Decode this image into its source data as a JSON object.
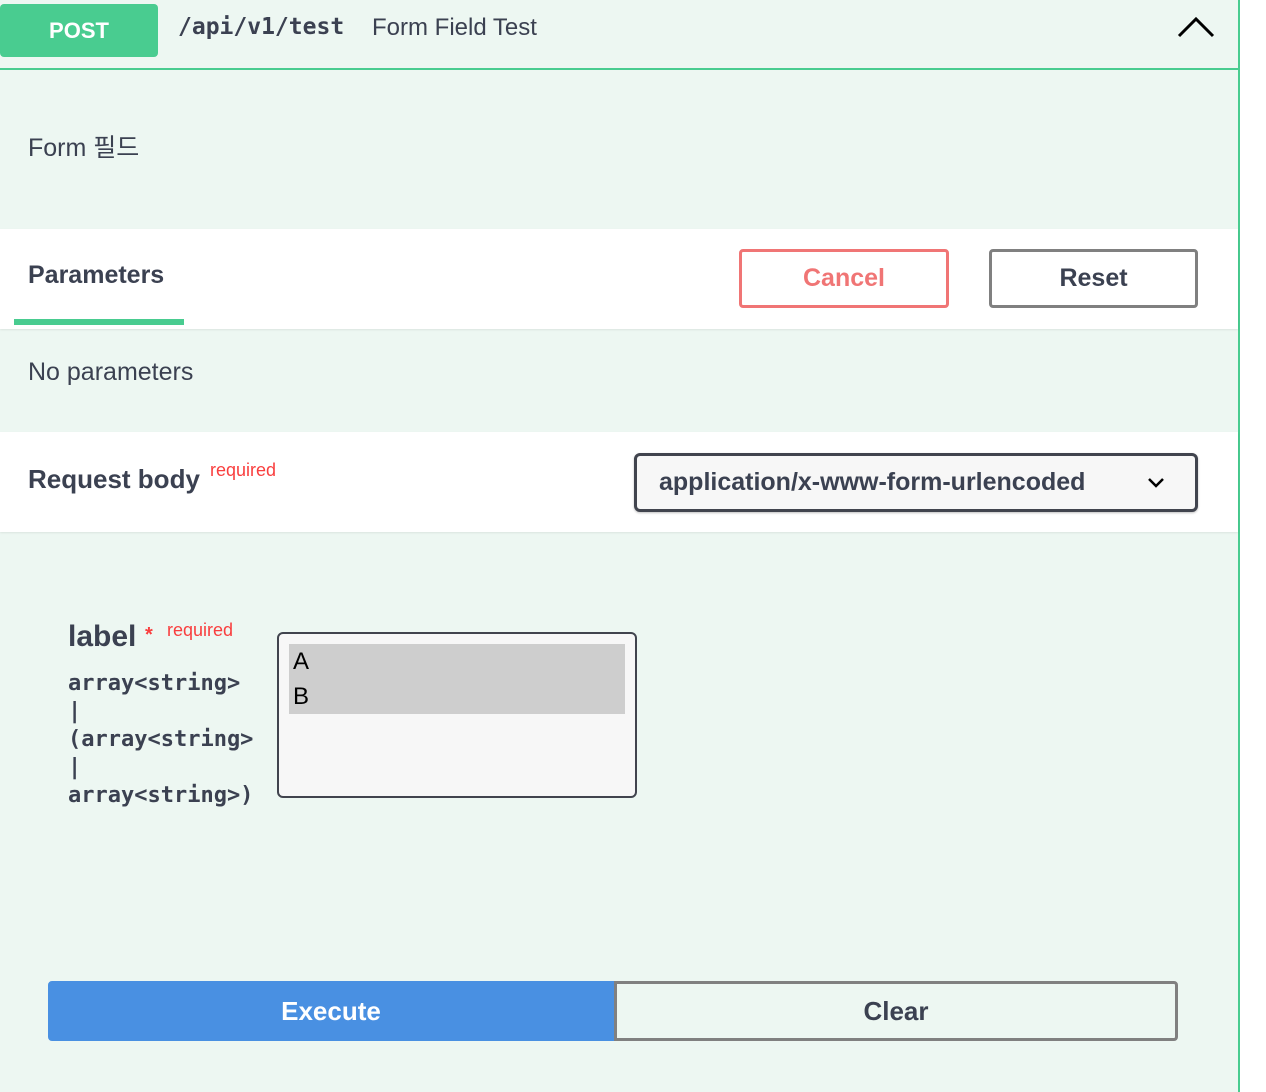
{
  "operation": {
    "method": "POST",
    "path": "/api/v1/test",
    "summary": "Form Field Test",
    "description": "Form 필드",
    "collapse_icon": "chevron-up-icon"
  },
  "parameters_section": {
    "tab_label": "Parameters",
    "cancel_label": "Cancel",
    "reset_label": "Reset",
    "empty_text": "No parameters"
  },
  "request_body": {
    "title": "Request body",
    "required_label": "required",
    "content_type": "application/x-www-form-urlencoded",
    "content_type_icon": "chevron-down-icon"
  },
  "form_field": {
    "name": "label",
    "star": "*",
    "required_label": "required",
    "type": "array<string>\n|\n(array<string>\n|\narray<string>)",
    "options": [
      "A",
      "B"
    ]
  },
  "actions": {
    "execute_label": "Execute",
    "clear_label": "Clear"
  },
  "colors": {
    "method_post": "#49cc90",
    "background": "#edf7f2",
    "cancel": "#f07575",
    "execute": "#4990e2",
    "required": "#f93e3e"
  }
}
